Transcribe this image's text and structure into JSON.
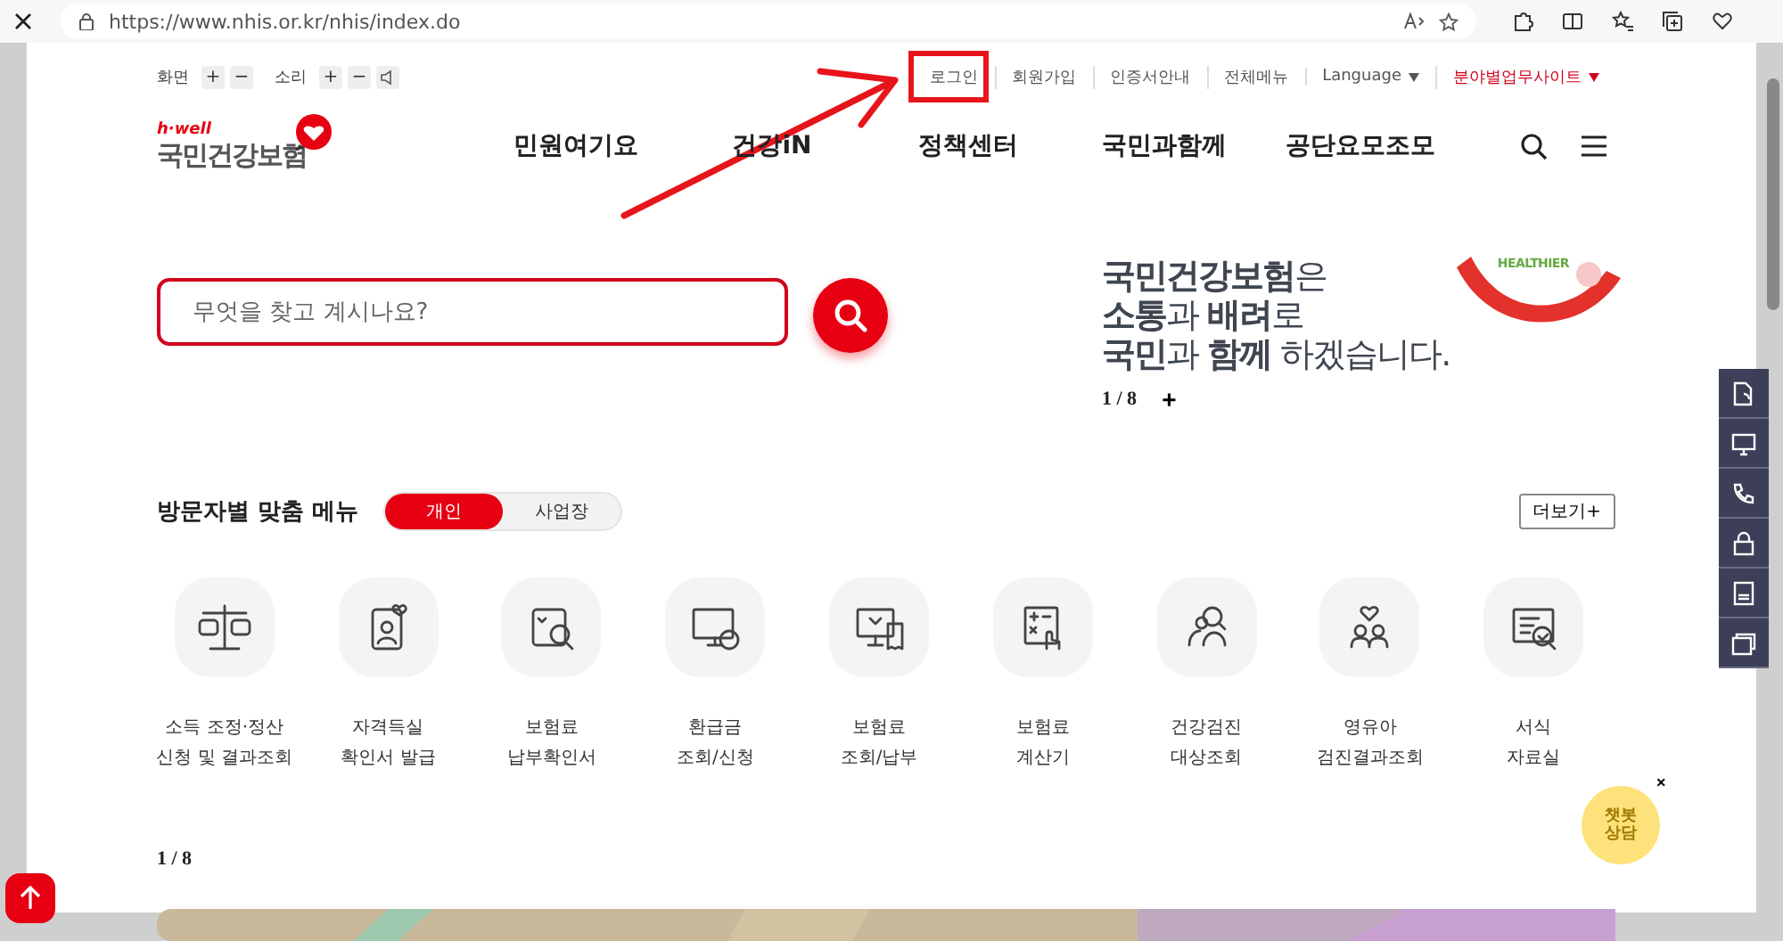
{
  "browser": {
    "url": "https://www.nhis.or.kr/nhis/index.do"
  },
  "utility": {
    "screen_label": "화면",
    "sound_label": "소리",
    "zoom_buttons": [
      "+",
      "−"
    ],
    "sound_buttons": [
      "+",
      "−"
    ],
    "links": [
      {
        "label": "로그인",
        "kind": "plain"
      },
      {
        "label": "회원가입",
        "kind": "plain"
      },
      {
        "label": "인증서안내",
        "kind": "plain"
      },
      {
        "label": "전체메뉴",
        "kind": "plain"
      },
      {
        "label": "Language",
        "kind": "dropdown"
      },
      {
        "label": "분야별업무사이트",
        "kind": "dropdown-accent"
      }
    ]
  },
  "logo": {
    "tagline": "h·well",
    "name": "국민건강보험"
  },
  "nav": {
    "items": [
      "민원여기요",
      "건강iN",
      "정책센터",
      "국민과함께",
      "공단요모조모"
    ]
  },
  "search": {
    "placeholder": "무엇을 찾고 계시나요?"
  },
  "banner": {
    "lines": [
      "**국민건강보험**은",
      "**소통**과 **배려**로",
      "**국민**과 **함께** 하겠습니다."
    ],
    "badge": "HEALTHIER",
    "pager": "1 / 8",
    "more": "+"
  },
  "visitor_menu": {
    "title": "방문자별 맞춤 메뉴",
    "tabs": [
      {
        "label": "개인",
        "selected": true
      },
      {
        "label": "사업장",
        "selected": false
      }
    ],
    "more": "더보기+",
    "items": [
      {
        "kind": "scale",
        "lines": [
          "소득 조정·정산",
          "신청 및 결과조회"
        ]
      },
      {
        "kind": "idcard",
        "lines": [
          "자격득실",
          "확인서 발급"
        ]
      },
      {
        "kind": "docsearch",
        "lines": [
          "보험료",
          "납부확인서"
        ]
      },
      {
        "kind": "monitor",
        "lines": [
          "환급금",
          "조회/신청"
        ]
      },
      {
        "kind": "receipt",
        "lines": [
          "보험료",
          "조회/납부"
        ]
      },
      {
        "kind": "calculator",
        "lines": [
          "보험료",
          "계산기"
        ]
      },
      {
        "kind": "people",
        "lines": [
          "건강검진",
          "대상조회"
        ]
      },
      {
        "kind": "family",
        "lines": [
          "영유아",
          "검진결과조회"
        ]
      },
      {
        "kind": "doccheck",
        "lines": [
          "서식",
          "자료실"
        ]
      }
    ]
  },
  "pager": "1 / 8",
  "chatbot": {
    "lines": [
      "챗봇",
      "상담"
    ],
    "close": "×"
  }
}
